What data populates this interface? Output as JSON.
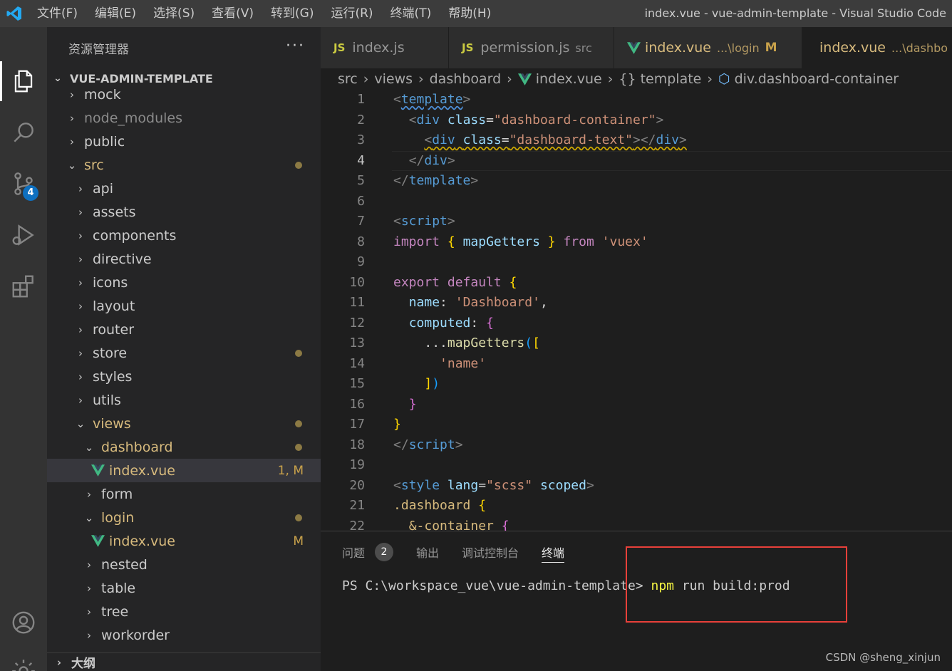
{
  "window": {
    "title": "index.vue - vue-admin-template - Visual Studio Code",
    "menu": [
      "文件(F)",
      "编辑(E)",
      "选择(S)",
      "查看(V)",
      "转到(G)",
      "运行(R)",
      "终端(T)",
      "帮助(H)"
    ]
  },
  "activity_bar": {
    "items": [
      "files-icon",
      "search-icon",
      "source-control-icon",
      "run-debug-icon",
      "extensions-icon",
      "account-icon",
      "settings-gear-icon"
    ],
    "source_control_badge": "4"
  },
  "sidebar": {
    "title": "资源管理器",
    "more": "···",
    "project": "VUE-ADMIN-TEMPLATE",
    "tree": [
      {
        "label": "mock",
        "kind": "folder",
        "depth": 1,
        "expanded": false
      },
      {
        "label": "node_modules",
        "kind": "folder",
        "depth": 1,
        "expanded": false,
        "dim": true
      },
      {
        "label": "public",
        "kind": "folder",
        "depth": 1,
        "expanded": false
      },
      {
        "label": "src",
        "kind": "folder",
        "depth": 1,
        "expanded": true,
        "modified": true,
        "dot": true
      },
      {
        "label": "api",
        "kind": "folder",
        "depth": 2,
        "expanded": false
      },
      {
        "label": "assets",
        "kind": "folder",
        "depth": 2,
        "expanded": false
      },
      {
        "label": "components",
        "kind": "folder",
        "depth": 2,
        "expanded": false
      },
      {
        "label": "directive",
        "kind": "folder",
        "depth": 2,
        "expanded": false
      },
      {
        "label": "icons",
        "kind": "folder",
        "depth": 2,
        "expanded": false
      },
      {
        "label": "layout",
        "kind": "folder",
        "depth": 2,
        "expanded": false
      },
      {
        "label": "router",
        "kind": "folder",
        "depth": 2,
        "expanded": false
      },
      {
        "label": "store",
        "kind": "folder",
        "depth": 2,
        "expanded": false,
        "dot": true
      },
      {
        "label": "styles",
        "kind": "folder",
        "depth": 2,
        "expanded": false
      },
      {
        "label": "utils",
        "kind": "folder",
        "depth": 2,
        "expanded": false
      },
      {
        "label": "views",
        "kind": "folder",
        "depth": 2,
        "expanded": true,
        "modified": true,
        "dot": true
      },
      {
        "label": "dashboard",
        "kind": "folder",
        "depth": 3,
        "expanded": true,
        "modified": true,
        "dot": true
      },
      {
        "label": "index.vue",
        "kind": "vue",
        "depth": 4,
        "modified": true,
        "status": "1, M",
        "active": true
      },
      {
        "label": "form",
        "kind": "folder",
        "depth": 3,
        "expanded": false
      },
      {
        "label": "login",
        "kind": "folder",
        "depth": 3,
        "expanded": true,
        "modified": true,
        "dot": true
      },
      {
        "label": "index.vue",
        "kind": "vue",
        "depth": 4,
        "modified": true,
        "status": "M"
      },
      {
        "label": "nested",
        "kind": "folder",
        "depth": 3,
        "expanded": false
      },
      {
        "label": "table",
        "kind": "folder",
        "depth": 3,
        "expanded": false
      },
      {
        "label": "tree",
        "kind": "folder",
        "depth": 3,
        "expanded": false
      },
      {
        "label": "workorder",
        "kind": "folder",
        "depth": 3,
        "expanded": false
      }
    ],
    "outline": "大纲"
  },
  "tabs": [
    {
      "icon": "JS",
      "label": "index.js",
      "desc": "",
      "mark": "",
      "modified": false,
      "active": false
    },
    {
      "icon": "JS",
      "label": "permission.js",
      "desc": "src",
      "mark": "",
      "modified": false,
      "active": false
    },
    {
      "icon": "vue",
      "label": "index.vue",
      "desc": "...\\login",
      "mark": "M",
      "modified": true,
      "active": false
    },
    {
      "icon": "vue",
      "label": "index.vue",
      "desc": "...\\dashbo",
      "mark": "",
      "modified": true,
      "active": true
    }
  ],
  "breadcrumb": [
    "src",
    "views",
    "dashboard",
    "index.vue",
    "{} template",
    "div.dashboard-container"
  ],
  "editor": {
    "current_line": 4,
    "lines": [
      {
        "n": "1",
        "s": [
          [
            "<",
            "br"
          ],
          [
            "template",
            "tag wb"
          ],
          [
            ">",
            "br"
          ]
        ]
      },
      {
        "n": "2",
        "s": [
          [
            "  ",
            "txt"
          ],
          [
            "<",
            "br"
          ],
          [
            "div",
            "tag"
          ],
          [
            " ",
            "txt"
          ],
          [
            "class",
            "attr"
          ],
          [
            "=",
            "txt"
          ],
          [
            "\"dashboard-container\"",
            "str"
          ],
          [
            ">",
            "br"
          ]
        ]
      },
      {
        "n": "3",
        "s": [
          [
            "    ",
            "txt"
          ],
          [
            "<",
            "br wy"
          ],
          [
            "div",
            "tag wy"
          ],
          [
            " ",
            "txt wy"
          ],
          [
            "class",
            "attr wy"
          ],
          [
            "=",
            "txt wy"
          ],
          [
            "\"dashboard-text\"",
            "str wy"
          ],
          [
            "></",
            "br wy"
          ],
          [
            "div",
            "tag wy"
          ],
          [
            ">",
            "br wy"
          ]
        ]
      },
      {
        "n": "4",
        "s": [
          [
            "  ",
            "txt"
          ],
          [
            "</",
            "br"
          ],
          [
            "div",
            "tag"
          ],
          [
            ">",
            "br"
          ]
        ]
      },
      {
        "n": "5",
        "s": [
          [
            "</",
            "br"
          ],
          [
            "template",
            "tag"
          ],
          [
            ">",
            "br"
          ]
        ]
      },
      {
        "n": "6",
        "s": []
      },
      {
        "n": "7",
        "s": [
          [
            "<",
            "br"
          ],
          [
            "script",
            "tag"
          ],
          [
            ">",
            "br"
          ]
        ]
      },
      {
        "n": "8",
        "s": [
          [
            "import",
            "kw"
          ],
          [
            " ",
            "txt"
          ],
          [
            "{",
            "p1"
          ],
          [
            " ",
            "txt"
          ],
          [
            "mapGetters",
            "attr"
          ],
          [
            " ",
            "txt"
          ],
          [
            "}",
            "p1"
          ],
          [
            " ",
            "txt"
          ],
          [
            "from",
            "kw"
          ],
          [
            " ",
            "txt"
          ],
          [
            "'vuex'",
            "str"
          ]
        ]
      },
      {
        "n": "9",
        "s": []
      },
      {
        "n": "10",
        "s": [
          [
            "export",
            "kw"
          ],
          [
            " ",
            "txt"
          ],
          [
            "default",
            "kw"
          ],
          [
            " ",
            "txt"
          ],
          [
            "{",
            "p1"
          ]
        ]
      },
      {
        "n": "11",
        "s": [
          [
            "  ",
            "txt"
          ],
          [
            "name",
            "attr"
          ],
          [
            ": ",
            "txt"
          ],
          [
            "'Dashboard'",
            "str"
          ],
          [
            ",",
            "txt"
          ]
        ]
      },
      {
        "n": "12",
        "s": [
          [
            "  ",
            "txt"
          ],
          [
            "computed",
            "attr"
          ],
          [
            ": ",
            "txt"
          ],
          [
            "{",
            "p2"
          ]
        ]
      },
      {
        "n": "13",
        "s": [
          [
            "    ",
            "txt"
          ],
          [
            "...",
            "txt"
          ],
          [
            "mapGetters",
            "fn"
          ],
          [
            "(",
            "p3"
          ],
          [
            "[",
            "p1"
          ]
        ]
      },
      {
        "n": "14",
        "s": [
          [
            "      ",
            "txt"
          ],
          [
            "'name'",
            "str"
          ]
        ]
      },
      {
        "n": "15",
        "s": [
          [
            "    ",
            "txt"
          ],
          [
            "]",
            "p1"
          ],
          [
            ")",
            "p3"
          ]
        ]
      },
      {
        "n": "16",
        "s": [
          [
            "  ",
            "txt"
          ],
          [
            "}",
            "p2"
          ]
        ]
      },
      {
        "n": "17",
        "s": [
          [
            "}",
            "p1"
          ]
        ]
      },
      {
        "n": "18",
        "s": [
          [
            "</",
            "br"
          ],
          [
            "script",
            "tag"
          ],
          [
            ">",
            "br"
          ]
        ]
      },
      {
        "n": "19",
        "s": []
      },
      {
        "n": "20",
        "s": [
          [
            "<",
            "br"
          ],
          [
            "style",
            "tag"
          ],
          [
            " ",
            "txt"
          ],
          [
            "lang",
            "attr"
          ],
          [
            "=",
            "txt"
          ],
          [
            "\"scss\"",
            "str"
          ],
          [
            " ",
            "txt"
          ],
          [
            "scoped",
            "attr"
          ],
          [
            ">",
            "br"
          ]
        ]
      },
      {
        "n": "21",
        "s": [
          [
            ".dashboard",
            "css"
          ],
          [
            " ",
            "txt"
          ],
          [
            "{",
            "p1"
          ]
        ]
      },
      {
        "n": "22",
        "s": [
          [
            "  ",
            "txt"
          ],
          [
            "&-container",
            "css"
          ],
          [
            " ",
            "txt"
          ],
          [
            "{",
            "p2"
          ]
        ]
      }
    ]
  },
  "panel": {
    "tabs": [
      "问题",
      "输出",
      "调试控制台",
      "终端"
    ],
    "active_tab": "终端",
    "problems_count": "2",
    "prompt": "PS C:\\workspace_vue\\vue-admin-template> ",
    "command": "npm",
    "args": " run build:prod"
  },
  "watermark": "CSDN @sheng_xinjun",
  "colors": {
    "accent_blue": "#0e70c0",
    "modified": "#d7ba7d",
    "highlight_box": "#e8403a",
    "vue_green": "#41b883"
  }
}
